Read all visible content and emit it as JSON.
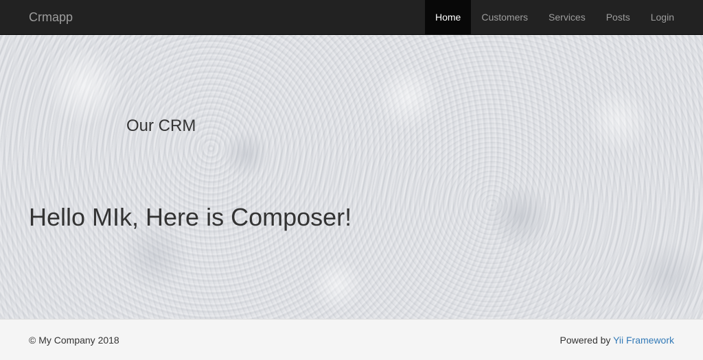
{
  "navbar": {
    "brand": "Crmapp",
    "items": [
      {
        "label": "Home",
        "active": true
      },
      {
        "label": "Customers",
        "active": false
      },
      {
        "label": "Services",
        "active": false
      },
      {
        "label": "Posts",
        "active": false
      },
      {
        "label": "Login",
        "active": false
      }
    ],
    "colors": {
      "background": "#222222",
      "text": "#9d9d9d",
      "active_background": "#080808",
      "active_text": "#ffffff"
    }
  },
  "hero": {
    "subtitle": "Our CRM",
    "title": "Hello MIk, Here is Composer!",
    "background": "snow-texture"
  },
  "footer": {
    "copyright": "© My Company 2018",
    "powered_prefix": "Powered by ",
    "powered_link": "Yii Framework",
    "colors": {
      "link": "#337ab7",
      "background": "#f5f5f5"
    }
  }
}
